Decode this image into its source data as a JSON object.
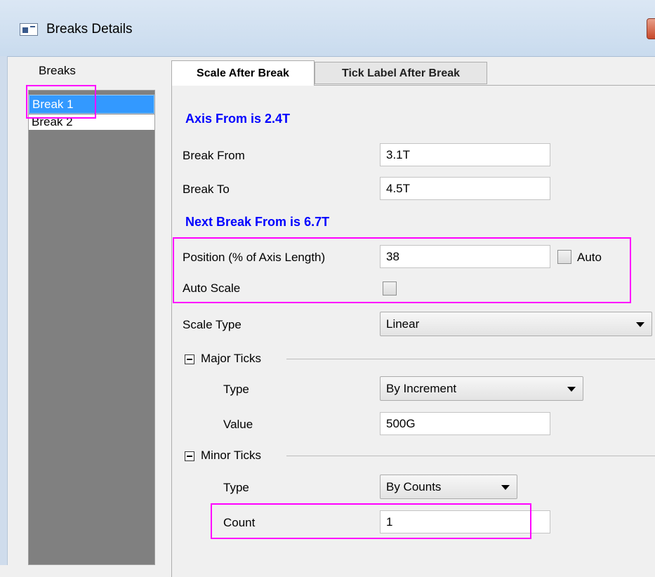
{
  "window": {
    "title": "Breaks Details"
  },
  "breaks": {
    "label": "Breaks",
    "items": [
      "Break 1",
      "Break 2"
    ],
    "selected": "Break 1"
  },
  "tabs": {
    "active": "Scale After Break",
    "inactive": "Tick Label After Break"
  },
  "form": {
    "axis_from": "Axis From is 2.4T",
    "break_from_label": "Break From",
    "break_from_value": "3.1T",
    "break_to_label": "Break To",
    "break_to_value": "4.5T",
    "next_break": "Next Break From is 6.7T",
    "position_label": "Position (% of Axis Length)",
    "position_value": "38",
    "auto_label": "Auto",
    "auto_scale_label": "Auto Scale",
    "scale_type_label": "Scale Type",
    "scale_type_value": "Linear",
    "major_ticks": {
      "title": "Major Ticks",
      "type_label": "Type",
      "type_value": "By Increment",
      "value_label": "Value",
      "value_value": "500G"
    },
    "minor_ticks": {
      "title": "Minor Ticks",
      "type_label": "Type",
      "type_value": "By Counts",
      "count_label": "Count",
      "count_value": "1"
    }
  },
  "colors": {
    "highlight": "#ff00ff",
    "heading": "#0000ff",
    "selection": "#3399ff"
  }
}
